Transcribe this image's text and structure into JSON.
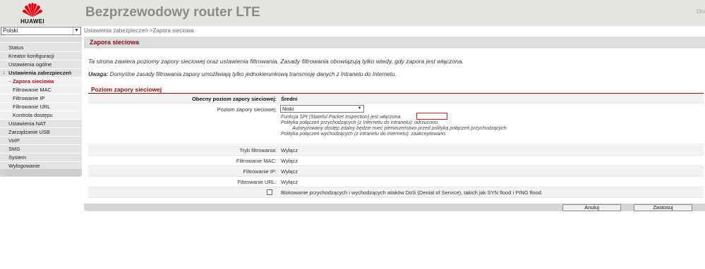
{
  "header": {
    "logo_text": "HUAWEI",
    "title": "Bezprzewodowy router LTE",
    "cut_text": "Ora"
  },
  "language": {
    "selected": "Polski"
  },
  "breadcrumb": "Ustawienia zabezpieczeń->Zapora sieciowa",
  "sidebar": {
    "items": [
      {
        "label": "Status"
      },
      {
        "label": "Kreator konfiguracji"
      },
      {
        "label": "Ustawienia ogólne"
      },
      {
        "label": "Ustawienia zabezpieczeń"
      },
      {
        "label": "Zapora sieciowa"
      },
      {
        "label": "Filtrowanie MAC"
      },
      {
        "label": "Filtrowanie IP"
      },
      {
        "label": "Filtrowanie URL"
      },
      {
        "label": "Kontrola dostępu"
      },
      {
        "label": "Ustawienia NAT"
      },
      {
        "label": "Zarządzanie USB"
      },
      {
        "label": "VoIP"
      },
      {
        "label": "SMS"
      },
      {
        "label": "System"
      },
      {
        "label": "Wylogowanie"
      }
    ]
  },
  "main": {
    "page_title": "Zapora sieciowa",
    "intro": "Ta strona zawiera poziomy zapory sieciowej oraz ustawienia filtrowania. Zasady filtrowania obowiązują tylko wtedy, gdy zapora jest włączona.",
    "note_label": "Uwaga:",
    "note_text": " Domyślne zasady filtrowania zapory umożliwiają tylko jednokierunkową transmisję danych z Intranetu do Internetu.",
    "section_title": "Poziom zapory sieciowej",
    "current_level_label": "Obecny poziom zapory sieciowej:",
    "current_level_value": "Średni",
    "level_label": "Poziom zapory sieciowej:",
    "level_selected": "Niski",
    "desc_line1": "Funkcja SPI (Stateful Packet Inspection) jest włączona.",
    "desc_line2": "Polityka połączeń przychodzących (z Internetu do intranetu): odrzucono.",
    "desc_line3": "Autoryzowany dostęp zdalny będzie mieć pierwszeństwo przed polityką połączeń przychodzących.",
    "desc_line4": "Polityka połączeń wychodzących (z intranetu do Internetu): zaakceptowano.",
    "filter_mode_label": "Tryb filtrowania:",
    "filter_mode_value": "Wyłącz",
    "mac_label": "Filtrowanie MAC:",
    "mac_value": "Wyłącz",
    "ip_label": "Filtrowanie IP:",
    "ip_value": "Wyłącz",
    "url_label": "Filtrowanie URL:",
    "url_value": "Wyłącz",
    "dos_text": "Blokowanie przychodzących i wychodzących ataków DoS (Denial of Service), takich jak SYN flood i PING flood.",
    "dos_checked": false
  },
  "buttons": {
    "cancel": "Anuluj",
    "apply": "Zastosuj"
  },
  "colors": {
    "accent": "#8b0a0a",
    "header_bg": "#e4e4e1",
    "logo_red": "#e60012",
    "highlight_box": "#e02020"
  }
}
